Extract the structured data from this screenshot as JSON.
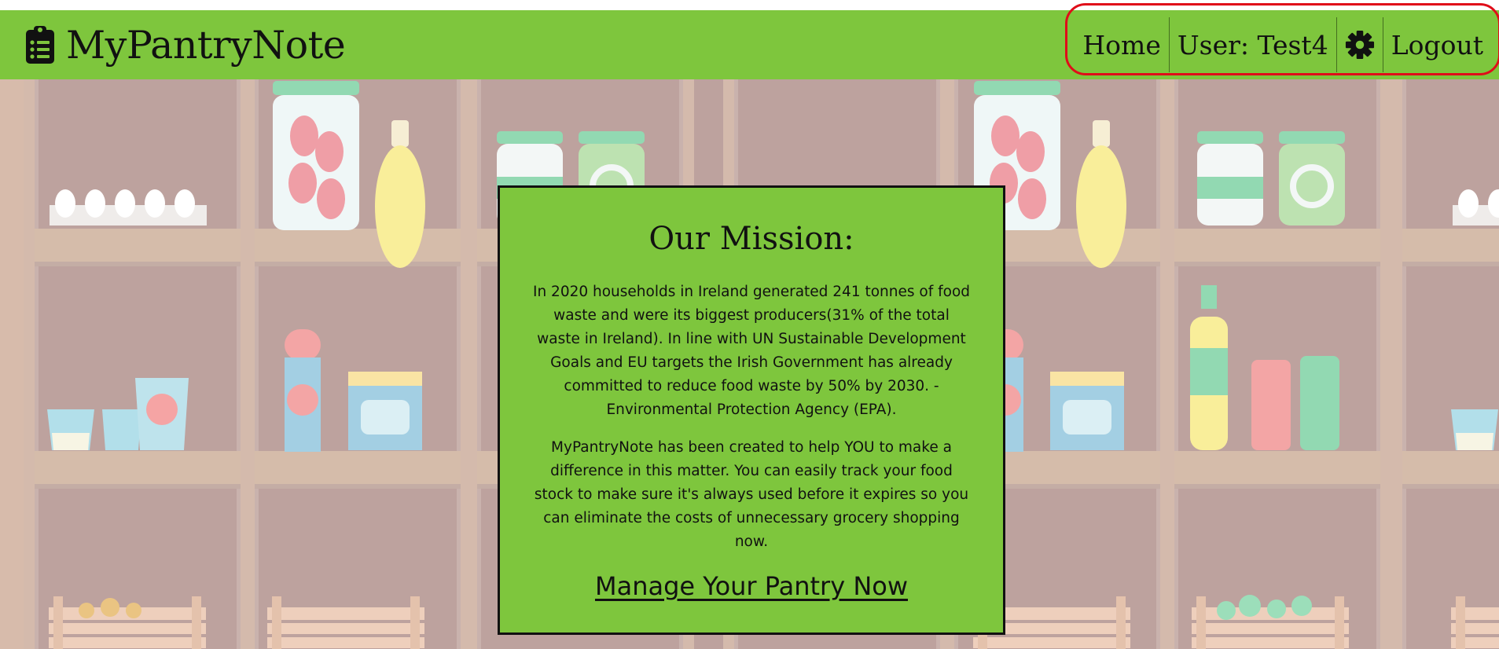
{
  "app": {
    "brand": "MyPantryNote",
    "icons": {
      "brand": "clipboard-list-icon",
      "settings": "gear-icon"
    },
    "colors": {
      "navbar": "#7ec63d",
      "card": "#7ec63d",
      "highlight": "#e00d19"
    }
  },
  "nav": {
    "home": "Home",
    "user": "User: Test4",
    "logout": "Logout"
  },
  "mission": {
    "title": "Our Mission:",
    "paragraph1": "In 2020 households in Ireland generated 241 tonnes of food waste and were its biggest producers(31% of the total waste in Ireland). In line with UN Sustainable Development Goals and EU targets the Irish Government has already committed to reduce food waste by 50% by 2030. -Environmental Protection Agency (EPA).",
    "paragraph2": "MyPantryNote has been created to help YOU to make a difference in this matter. You can easily track your food stock to make sure it's always used before it expires so you can eliminate the costs of unnecessary grocery shopping now.",
    "cta": "Manage Your Pantry Now"
  }
}
